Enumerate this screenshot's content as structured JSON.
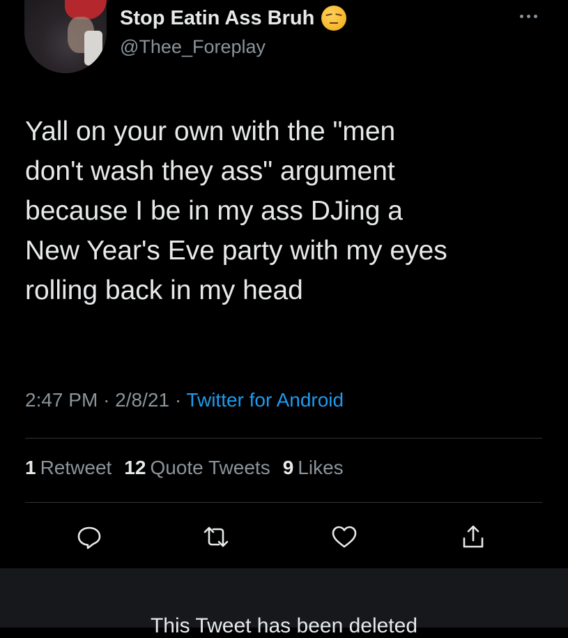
{
  "author": {
    "display_name": "Stop Eatin Ass Bruh",
    "name_emoji": "unamused-face-emoji",
    "handle": "@Thee_Foreplay"
  },
  "tweet": {
    "text": "Yall on your own with the \"men\ndon't wash they ass\" argument\nbecause I be in my ass DJing a\nNew Year's Eve party with my eyes\nrolling back in my head",
    "time": "2:47 PM",
    "separator": "·",
    "date": "2/8/21",
    "source": "Twitter for Android"
  },
  "stats": {
    "retweets_count": "1",
    "retweets_label": "Retweet",
    "quotes_count": "12",
    "quotes_label": "Quote Tweets",
    "likes_count": "9",
    "likes_label": "Likes"
  },
  "actions": [
    "reply-icon",
    "retweet-icon",
    "like-icon",
    "share-icon"
  ],
  "deleted_notice": "This Tweet has been deleted",
  "colors": {
    "background": "#000000",
    "text_primary": "#e7e9ea",
    "text_secondary": "#8b949b",
    "link": "#1d9bf0",
    "divider": "#2f3336",
    "deleted_bg": "#16181c"
  }
}
